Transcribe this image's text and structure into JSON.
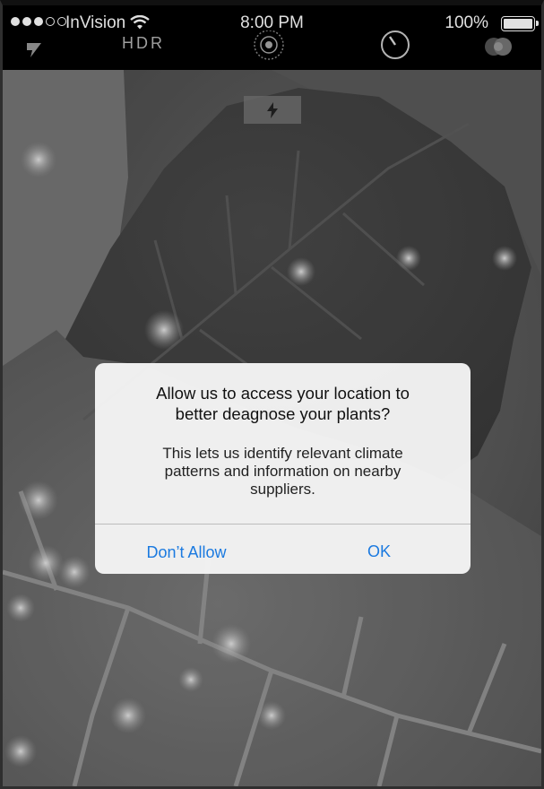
{
  "status_bar": {
    "carrier": "InVision",
    "time": "8:00 PM",
    "battery": "100%",
    "signal_icon": "signal-dots-icon",
    "wifi_icon": "wifi-icon",
    "battery_icon": "battery-icon"
  },
  "camera": {
    "hdr_label": "HDR",
    "flash_auto_icon": "flash-auto-icon",
    "live_icon": "live-photo-icon",
    "timer_icon": "timer-icon",
    "filter_icon": "filter-icon",
    "flash_indicator_icon": "flash-icon"
  },
  "alert": {
    "title_line1": "Allow us to access your location to",
    "title_line2": "better deagnose your plants?",
    "message_line1": "This lets us identify relevant climate",
    "message_line2": "patterns and information on nearby",
    "message_line3": "suppliers.",
    "deny_label": "Don’t Allow",
    "ok_label": "OK"
  },
  "colors": {
    "accent": "#1b7ae0",
    "alert_bg": "#f4f4f4",
    "top_bar_bg": "#000000"
  }
}
